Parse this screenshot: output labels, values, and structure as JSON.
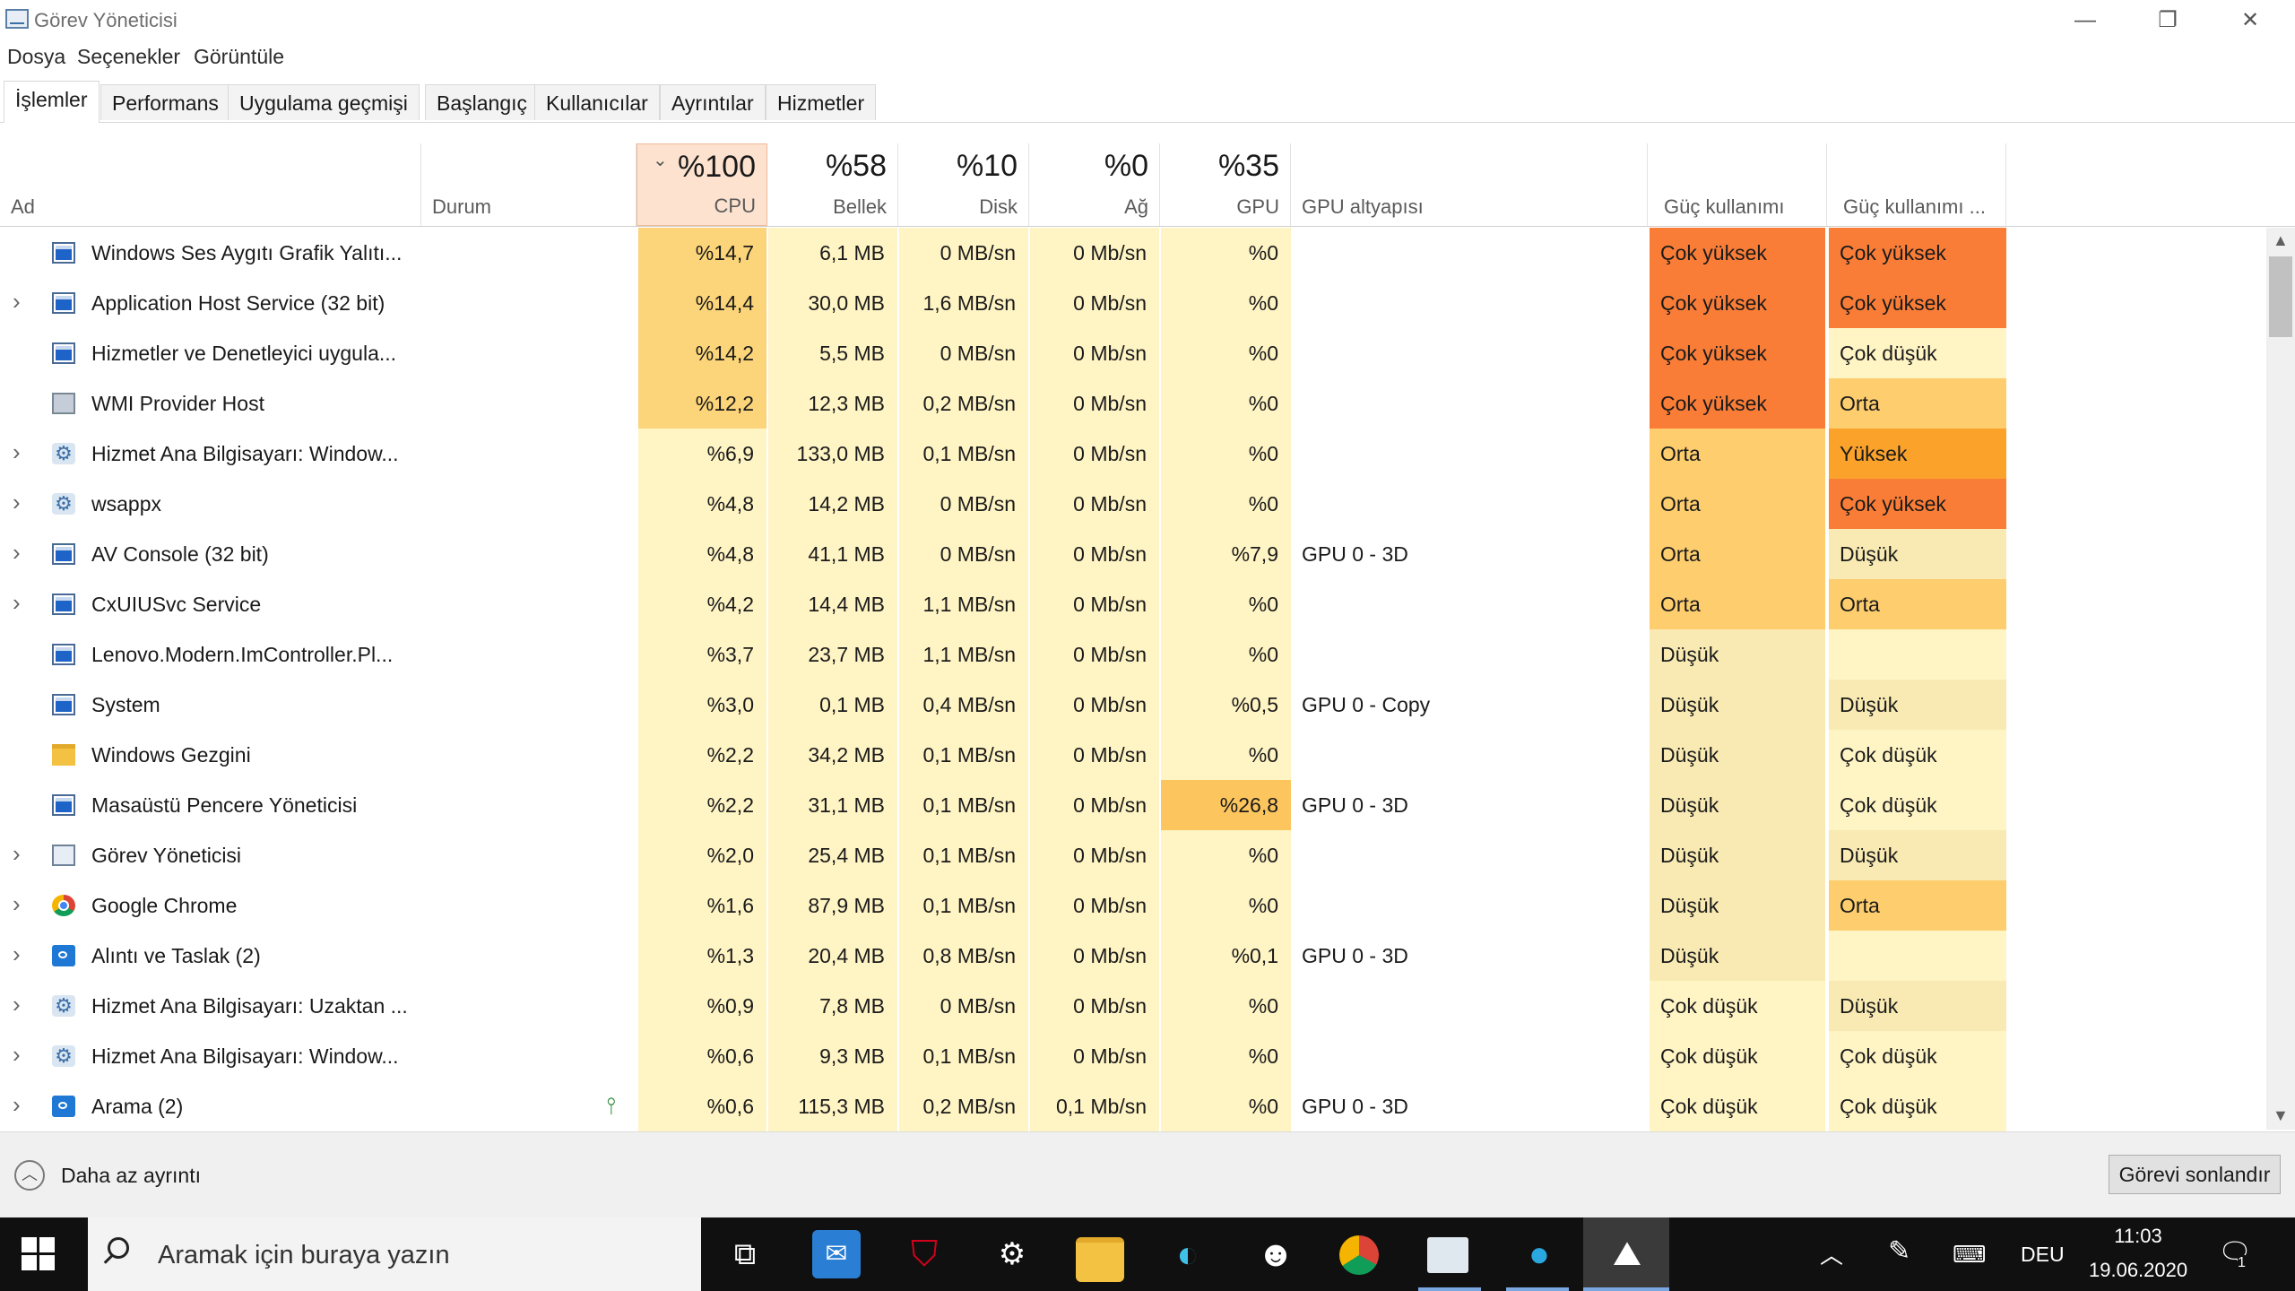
{
  "window": {
    "title": "Görev Yöneticisi",
    "minimize_glyph": "—",
    "maximize_glyph": "❐",
    "close_glyph": "✕"
  },
  "menu": [
    "Dosya",
    "Seçenekler",
    "Görüntüle"
  ],
  "tabs": [
    "İşlemler",
    "Performans",
    "Uygulama geçmişi",
    "Başlangıç",
    "Kullanıcılar",
    "Ayrıntılar",
    "Hizmetler"
  ],
  "columns": {
    "name": "Ad",
    "status": "Durum",
    "cpu": {
      "pct": "%100",
      "label": "CPU"
    },
    "memory": {
      "pct": "%58",
      "label": "Bellek"
    },
    "disk": {
      "pct": "%10",
      "label": "Disk"
    },
    "network": {
      "pct": "%0",
      "label": "Ağ"
    },
    "gpu": {
      "pct": "%35",
      "label": "GPU"
    },
    "gpu_engine": "GPU altyapısı",
    "power": "Güç kullanımı",
    "power_trend": "Güç kullanımı ..."
  },
  "colors": {
    "cpu_high": "#fcd57a",
    "cell_default": "#fff4c4",
    "power_very_high": "#fa7d37",
    "power_high": "#fba22b",
    "power_medium": "#fdcd6e",
    "power_low": "#f8eab2",
    "power_very_low": "#fff4c4",
    "gpu_high": "#fcc55e"
  },
  "rows": [
    {
      "expand": false,
      "icon": "window-icon",
      "name": "Windows Ses Aygıtı Grafik Yalıtı...",
      "cpu": "%14,7",
      "mem": "6,1 MB",
      "disk": "0 MB/sn",
      "net": "0 Mb/sn",
      "gpu": "%0",
      "engine": "",
      "power": "Çok yüksek",
      "trend": "Çok yüksek",
      "cpu_level": "high",
      "gpu_level": "none"
    },
    {
      "expand": true,
      "icon": "window-icon",
      "name": "Application Host Service (32 bit)",
      "cpu": "%14,4",
      "mem": "30,0 MB",
      "disk": "1,6 MB/sn",
      "net": "0 Mb/sn",
      "gpu": "%0",
      "engine": "",
      "power": "Çok yüksek",
      "trend": "Çok yüksek",
      "cpu_level": "high",
      "gpu_level": "none"
    },
    {
      "expand": false,
      "icon": "window-icon",
      "name": "Hizmetler ve Denetleyici uygula...",
      "cpu": "%14,2",
      "mem": "5,5 MB",
      "disk": "0 MB/sn",
      "net": "0 Mb/sn",
      "gpu": "%0",
      "engine": "",
      "power": "Çok yüksek",
      "trend": "Çok düşük",
      "cpu_level": "high",
      "gpu_level": "none"
    },
    {
      "expand": false,
      "icon": "wmi-icon",
      "name": "WMI Provider Host",
      "cpu": "%12,2",
      "mem": "12,3 MB",
      "disk": "0,2 MB/sn",
      "net": "0 Mb/sn",
      "gpu": "%0",
      "engine": "",
      "power": "Çok yüksek",
      "trend": "Orta",
      "cpu_level": "high",
      "gpu_level": "none"
    },
    {
      "expand": true,
      "icon": "gear-icon",
      "name": "Hizmet Ana Bilgisayarı: Window...",
      "cpu": "%6,9",
      "mem": "133,0 MB",
      "disk": "0,1 MB/sn",
      "net": "0 Mb/sn",
      "gpu": "%0",
      "engine": "",
      "power": "Orta",
      "trend": "Yüksek",
      "cpu_level": "low",
      "gpu_level": "none"
    },
    {
      "expand": true,
      "icon": "gear-icon",
      "name": "wsappx",
      "cpu": "%4,8",
      "mem": "14,2 MB",
      "disk": "0 MB/sn",
      "net": "0 Mb/sn",
      "gpu": "%0",
      "engine": "",
      "power": "Orta",
      "trend": "Çok yüksek",
      "cpu_level": "low",
      "gpu_level": "none"
    },
    {
      "expand": true,
      "icon": "window-icon",
      "name": "AV Console (32 bit)",
      "cpu": "%4,8",
      "mem": "41,1 MB",
      "disk": "0 MB/sn",
      "net": "0 Mb/sn",
      "gpu": "%7,9",
      "engine": "GPU 0 - 3D",
      "power": "Orta",
      "trend": "Düşük",
      "cpu_level": "low",
      "gpu_level": "low"
    },
    {
      "expand": true,
      "icon": "window-icon",
      "name": "CxUIUSvc Service",
      "cpu": "%4,2",
      "mem": "14,4 MB",
      "disk": "1,1 MB/sn",
      "net": "0 Mb/sn",
      "gpu": "%0",
      "engine": "",
      "power": "Orta",
      "trend": "Orta",
      "cpu_level": "low",
      "gpu_level": "none"
    },
    {
      "expand": false,
      "icon": "window-icon",
      "name": "Lenovo.Modern.ImController.Pl...",
      "cpu": "%3,7",
      "mem": "23,7 MB",
      "disk": "1,1 MB/sn",
      "net": "0 Mb/sn",
      "gpu": "%0",
      "engine": "",
      "power": "Düşük",
      "trend": "",
      "cpu_level": "low",
      "gpu_level": "none"
    },
    {
      "expand": false,
      "icon": "window-icon",
      "name": "System",
      "cpu": "%3,0",
      "mem": "0,1 MB",
      "disk": "0,4 MB/sn",
      "net": "0 Mb/sn",
      "gpu": "%0,5",
      "engine": "GPU 0 - Copy",
      "power": "Düşük",
      "trend": "Düşük",
      "cpu_level": "low",
      "gpu_level": "low"
    },
    {
      "expand": false,
      "icon": "folder-icon",
      "name": "Windows Gezgini",
      "cpu": "%2,2",
      "mem": "34,2 MB",
      "disk": "0,1 MB/sn",
      "net": "0 Mb/sn",
      "gpu": "%0",
      "engine": "",
      "power": "Düşük",
      "trend": "Çok düşük",
      "cpu_level": "low",
      "gpu_level": "none"
    },
    {
      "expand": false,
      "icon": "window-icon",
      "name": "Masaüstü Pencere Yöneticisi",
      "cpu": "%2,2",
      "mem": "31,1 MB",
      "disk": "0,1 MB/sn",
      "net": "0 Mb/sn",
      "gpu": "%26,8",
      "engine": "GPU 0 - 3D",
      "power": "Düşük",
      "trend": "Çok düşük",
      "cpu_level": "low",
      "gpu_level": "high"
    },
    {
      "expand": true,
      "icon": "task-manager-icon",
      "name": "Görev Yöneticisi",
      "cpu": "%2,0",
      "mem": "25,4 MB",
      "disk": "0,1 MB/sn",
      "net": "0 Mb/sn",
      "gpu": "%0",
      "engine": "",
      "power": "Düşük",
      "trend": "Düşük",
      "cpu_level": "low",
      "gpu_level": "none"
    },
    {
      "expand": true,
      "icon": "chrome-icon",
      "name": "Google Chrome",
      "cpu": "%1,6",
      "mem": "87,9 MB",
      "disk": "0,1 MB/sn",
      "net": "0 Mb/sn",
      "gpu": "%0",
      "engine": "",
      "power": "Düşük",
      "trend": "Orta",
      "cpu_level": "low",
      "gpu_level": "none"
    },
    {
      "expand": true,
      "icon": "snip-icon",
      "name": "Alıntı ve Taslak (2)",
      "cpu": "%1,3",
      "mem": "20,4 MB",
      "disk": "0,8 MB/sn",
      "net": "0 Mb/sn",
      "gpu": "%0,1",
      "engine": "GPU 0 - 3D",
      "power": "Düşük",
      "trend": "",
      "cpu_level": "low",
      "gpu_level": "low"
    },
    {
      "expand": true,
      "icon": "gear-icon",
      "name": "Hizmet Ana Bilgisayarı: Uzaktan ...",
      "cpu": "%0,9",
      "mem": "7,8 MB",
      "disk": "0 MB/sn",
      "net": "0 Mb/sn",
      "gpu": "%0",
      "engine": "",
      "power": "Çok düşük",
      "trend": "Düşük",
      "cpu_level": "low",
      "gpu_level": "none"
    },
    {
      "expand": true,
      "icon": "gear-icon",
      "name": "Hizmet Ana Bilgisayarı: Window...",
      "cpu": "%0,6",
      "mem": "9,3 MB",
      "disk": "0,1 MB/sn",
      "net": "0 Mb/sn",
      "gpu": "%0",
      "engine": "",
      "power": "Çok düşük",
      "trend": "Çok düşük",
      "cpu_level": "low",
      "gpu_level": "none"
    },
    {
      "expand": true,
      "icon": "search-app-icon",
      "name": "Arama (2)",
      "cpu": "%0,6",
      "mem": "115,3 MB",
      "disk": "0,2 MB/sn",
      "net": "0,1 Mb/sn",
      "gpu": "%0",
      "engine": "GPU 0 - 3D",
      "power": "Çok düşük",
      "trend": "Çok düşük",
      "cpu_level": "low",
      "gpu_level": "none",
      "suspended_leaf": true
    }
  ],
  "footer": {
    "less_details": "Daha az ayrıntı",
    "end_task": "Görevi sonlandır"
  },
  "taskbar": {
    "search_placeholder": "Aramak için buraya yazın",
    "apps": [
      "task-view-icon",
      "mail-icon",
      "mcafee-icon",
      "settings-icon",
      "explorer-icon",
      "edge-icon",
      "panda-icon",
      "chrome-icon",
      "task-manager-icon",
      "app-icon",
      "photos-icon"
    ],
    "language": "DEU",
    "time": "11:03",
    "date": "19.06.2020",
    "notifications": "1"
  }
}
